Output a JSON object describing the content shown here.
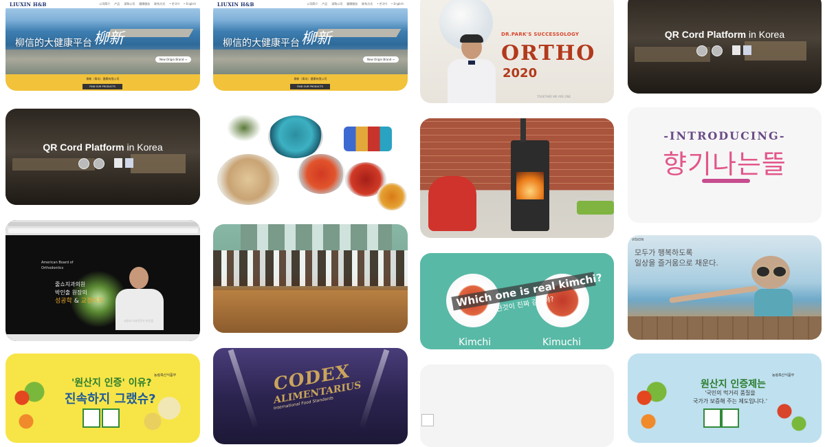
{
  "liuxin": {
    "logo": "LIUXIN H&B",
    "nav_links": [
      "公司简介",
      "产品",
      "采购公司",
      "健康服务",
      "联系方式",
      "• 한국어",
      "• English"
    ],
    "slogan": "柳信的大健康平台",
    "brush_text": "柳新",
    "pill": "New Origin Brand →",
    "footer_company": "柳新（青岛）健康有限公司",
    "footer_button": "FIND OUR PRODUCTS"
  },
  "qr": {
    "title_bold": "QR Cord Platform",
    "title_rest": " in Korea"
  },
  "ortho": {
    "top_line": "DR.PARK'S SUCCESSOLOGY",
    "word": "ORTHO",
    "year": "2020",
    "bottom_line": "TOGETHER WE ARE ONE"
  },
  "introducing": {
    "label": "-INTRODUCING-",
    "korean": "향기나는뜰"
  },
  "browser": {
    "org_line1": "American Board of",
    "org_line2": "Orthodontics",
    "line1": "줄쇼지과의원",
    "line2": "박인출 원장의",
    "line3_a": "성공학",
    "line3_b": " & ",
    "line3_c": "교정비학",
    "caption": "사람과 치과전문가 박인출"
  },
  "kimchi": {
    "question_en": "Which one is real kimchi?",
    "question_ko": "어떤것이 진짜 김치야?",
    "left": "Kimchi",
    "right": "Kimuchi"
  },
  "happy": {
    "tag": "VISION",
    "line1": "모두가 행복하도록",
    "line2": "일상을 즐거움으로 채운다."
  },
  "origin_left": {
    "title": "'원산지 인증' 이유?",
    "subtitle": "진속하지 그랬슈?",
    "ministry": "농림축산식품부"
  },
  "codex": {
    "line1": "CODEX",
    "line2": "ALIMENTARIUS",
    "line3": "International Food Standards"
  },
  "origin_right": {
    "title": "원산지 인증제는",
    "line1": "'국민의 먹거리 품질을",
    "line2": "국가가 보증해 주는 제도입니다.'",
    "ministry": "농림축산식품부"
  }
}
